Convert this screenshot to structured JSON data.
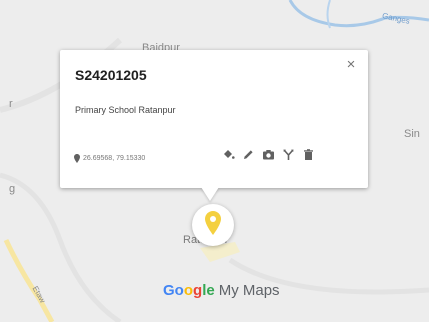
{
  "map": {
    "labels": {
      "top_place": "Baidpur",
      "river_name": "Ganges",
      "right_place": "Sin",
      "left_char_1": "r",
      "left_char_2": "g",
      "town": "Ratanpur",
      "road_label": "Etaw"
    }
  },
  "popup": {
    "title": "S24201205",
    "description": "Primary School Ratanpur",
    "coordinates": "26.69568, 79.15330",
    "close_glyph": "×",
    "actions": [
      "paint-bucket-icon",
      "edit-pencil-icon",
      "camera-icon",
      "directions-icon",
      "delete-icon"
    ]
  },
  "branding": {
    "google_parts": [
      "Go",
      "o",
      "g",
      "le"
    ],
    "product": "My Maps"
  },
  "colors": {
    "marker": "#f4d03f",
    "river": "#9ec3e6",
    "road": "#f7e7a6"
  }
}
